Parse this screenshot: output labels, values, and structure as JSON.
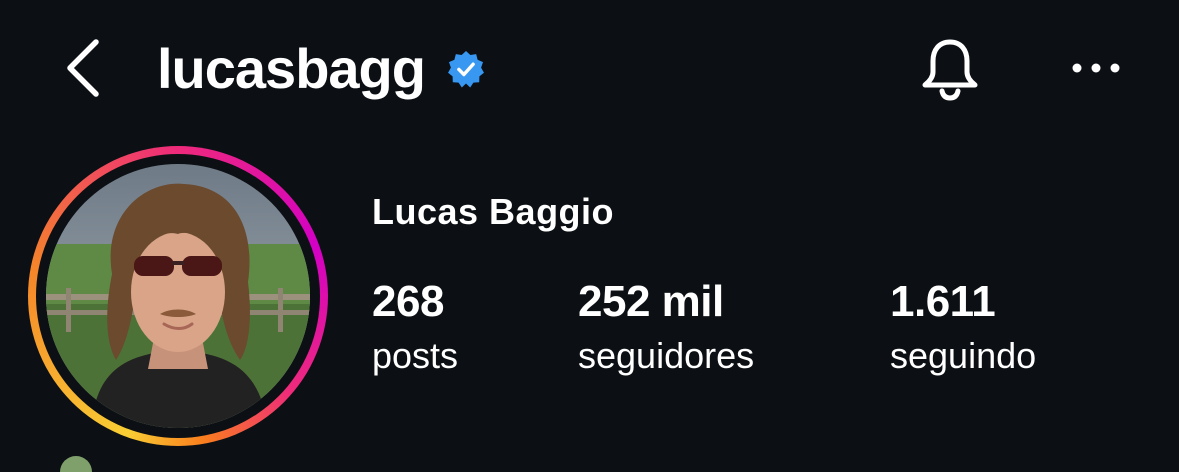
{
  "header": {
    "username": "lucasbagg",
    "back_icon": "chevron-left-icon",
    "verified_icon": "verified-badge-icon",
    "verified_color": "#3897f0",
    "bell_icon": "bell-icon",
    "more_icon": "more-horizontal-icon"
  },
  "profile": {
    "display_name": "Lucas Baggio",
    "avatar_icon": "profile-photo",
    "story_ring_colors": [
      "#f9ce34",
      "#ee2a7b",
      "#d300c5"
    ],
    "stats": {
      "posts": {
        "value": "268",
        "label": "posts"
      },
      "followers": {
        "value": "252 mil",
        "label": "seguidores"
      },
      "following": {
        "value": "1.611",
        "label": "seguindo"
      }
    }
  },
  "colors": {
    "background": "#0c1014",
    "text": "#ffffff"
  }
}
